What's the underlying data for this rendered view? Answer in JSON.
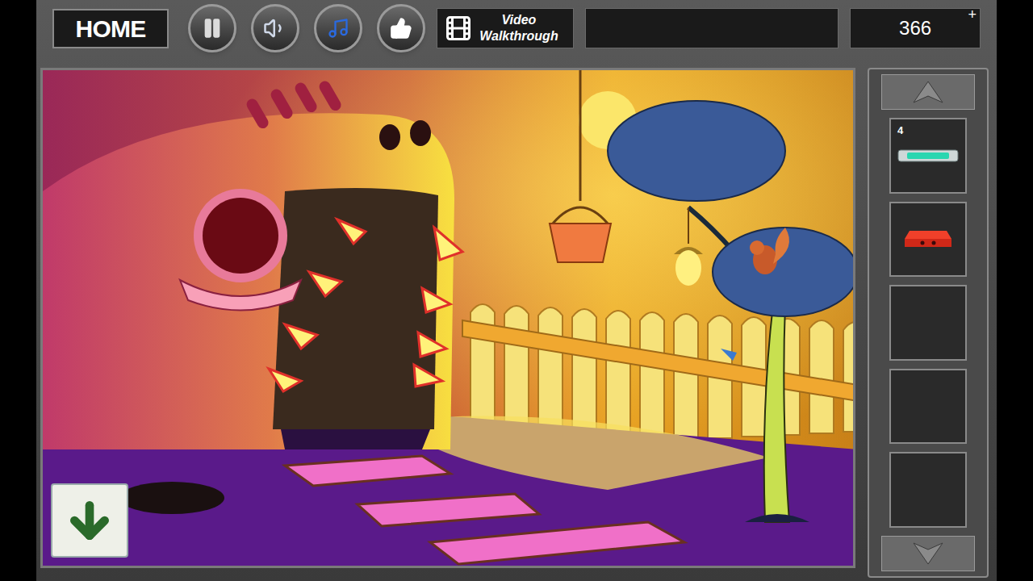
{
  "toolbar": {
    "home": "HOME",
    "video_walkthrough": [
      "Video",
      "Walkthrough"
    ],
    "score": "366",
    "plus": "+"
  },
  "inventory": [
    {
      "kind": "bar",
      "count": "4"
    },
    {
      "kind": "block",
      "count": ""
    },
    {
      "kind": "empty",
      "count": ""
    },
    {
      "kind": "empty",
      "count": ""
    },
    {
      "kind": "empty",
      "count": ""
    }
  ]
}
